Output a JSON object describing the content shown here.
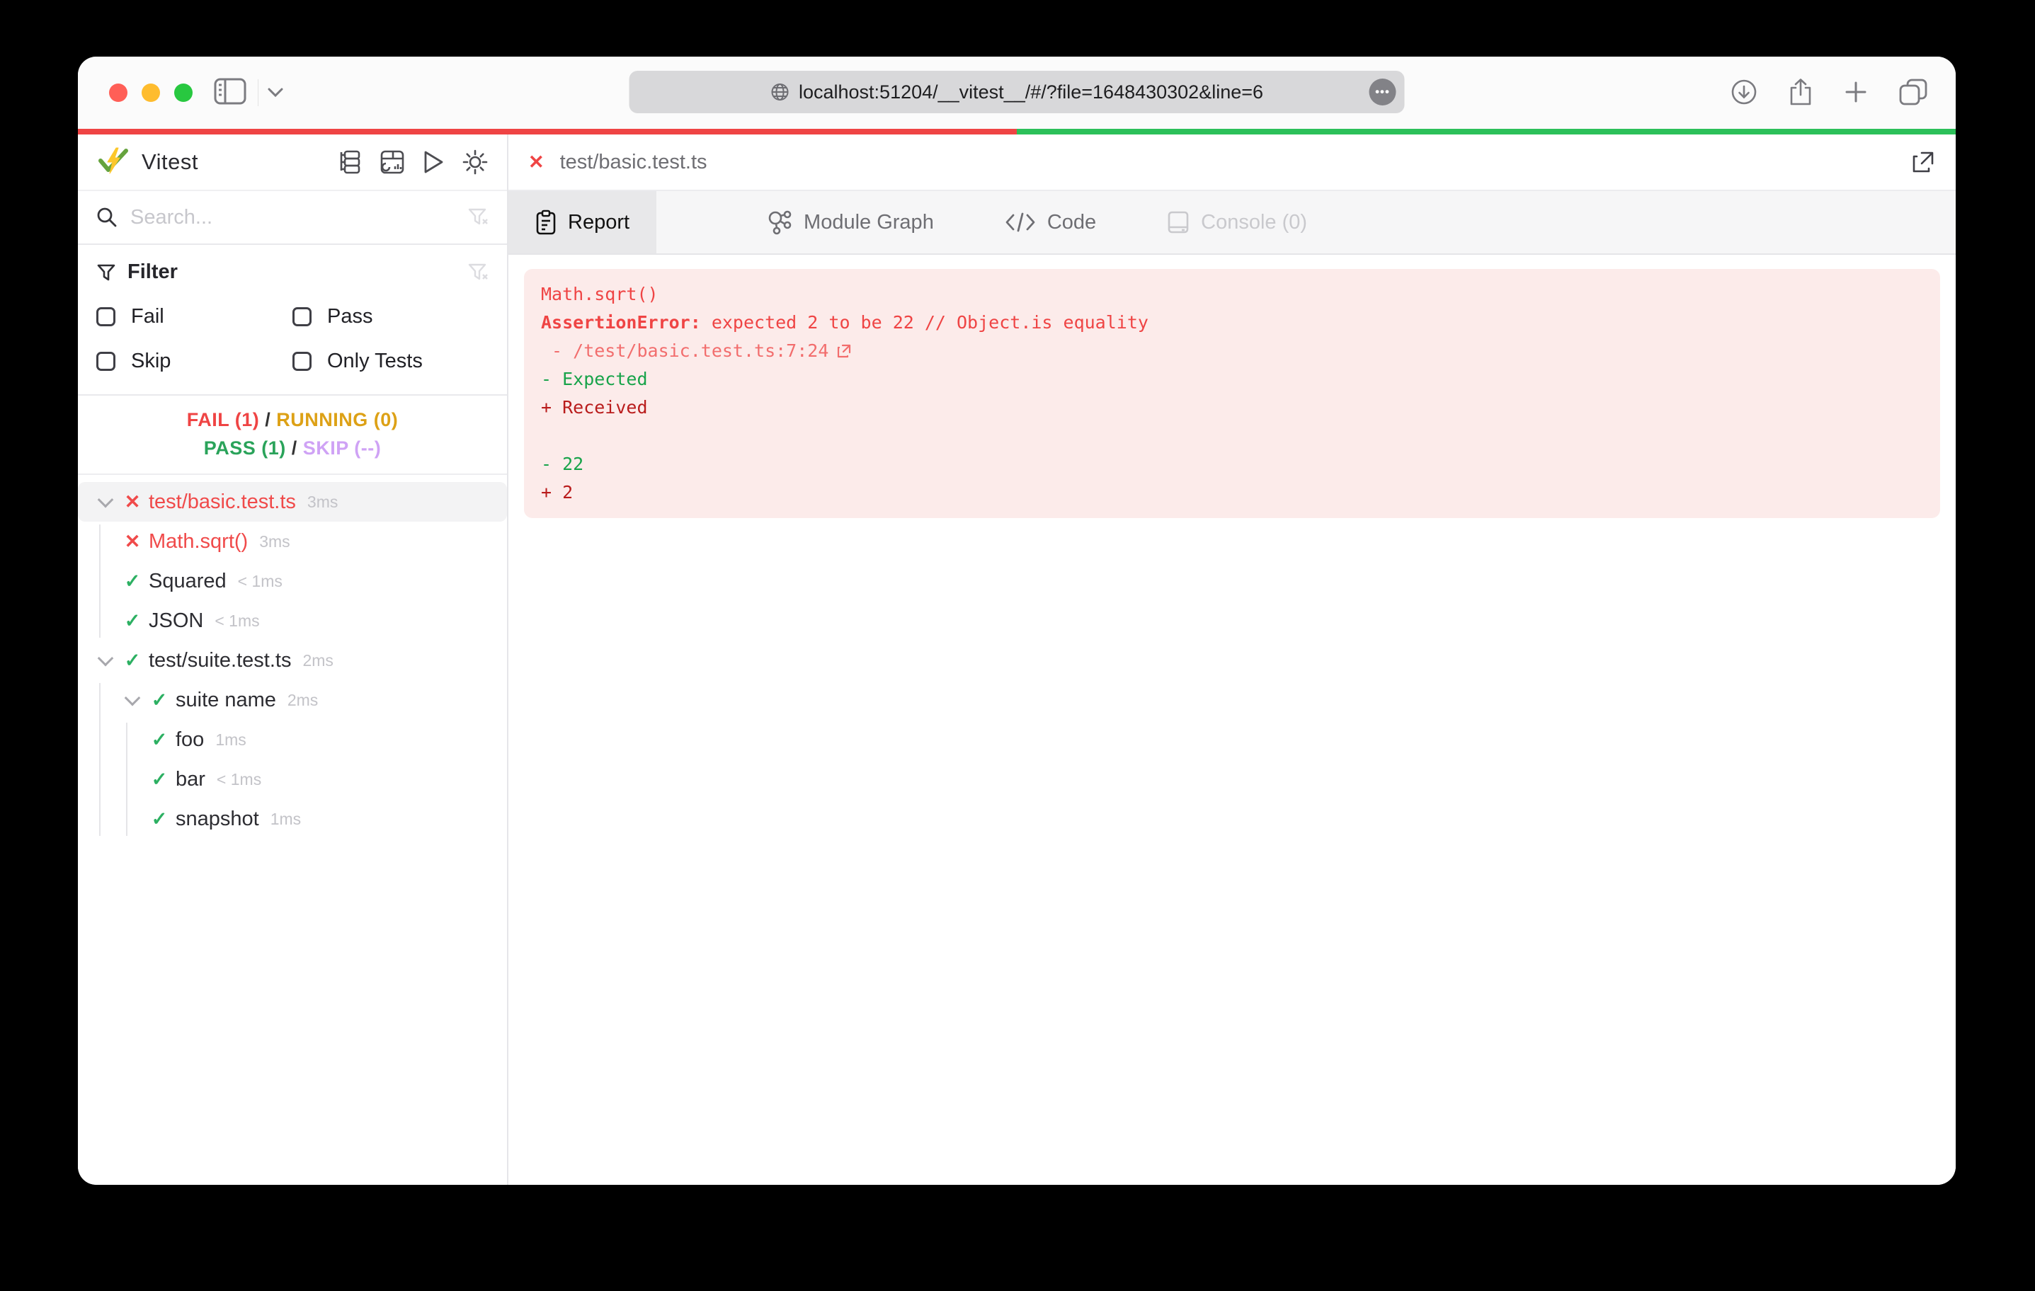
{
  "browser": {
    "url": "localhost:51204/__vitest__/#/?file=1648430302&line=6"
  },
  "colors": {
    "fail_red": "#ef4444",
    "pass_green": "#2cc05a",
    "running_amber": "#dda116",
    "skip_purple": "#cfa2f5",
    "error_panel_bg": "#fcebea",
    "diff_expected_green": "#18a34a",
    "diff_received_darkred": "#b91c1c"
  },
  "icons": {
    "fail_glyph": "✕",
    "pass_glyph": "✓"
  },
  "sidebar": {
    "title": "Vitest",
    "search_placeholder": "Search...",
    "filter": {
      "label": "Filter",
      "options": [
        "Fail",
        "Pass",
        "Skip",
        "Only Tests"
      ]
    },
    "summary": {
      "fail": "FAIL (1)",
      "running": "RUNNING (0)",
      "pass": "PASS (1)",
      "skip": "SKIP (--)",
      "sep": " / "
    },
    "tree": [
      {
        "label": "test/basic.test.ts",
        "duration": "3ms",
        "status": "fail",
        "level": 0,
        "expandable": true,
        "selected": true
      },
      {
        "label": "Math.sqrt()",
        "duration": "3ms",
        "status": "fail",
        "level": 1,
        "expandable": false,
        "selected": false
      },
      {
        "label": "Squared",
        "duration": "< 1ms",
        "status": "pass",
        "level": 1,
        "expandable": false,
        "selected": false
      },
      {
        "label": "JSON",
        "duration": "< 1ms",
        "status": "pass",
        "level": 1,
        "expandable": false,
        "selected": false
      },
      {
        "label": "test/suite.test.ts",
        "duration": "2ms",
        "status": "pass",
        "level": 0,
        "expandable": true,
        "selected": false
      },
      {
        "label": "suite name",
        "duration": "2ms",
        "status": "pass",
        "level": 1,
        "expandable": true,
        "selected": false
      },
      {
        "label": "foo",
        "duration": "1ms",
        "status": "pass",
        "level": 2,
        "expandable": false,
        "selected": false
      },
      {
        "label": "bar",
        "duration": "< 1ms",
        "status": "pass",
        "level": 2,
        "expandable": false,
        "selected": false
      },
      {
        "label": "snapshot",
        "duration": "1ms",
        "status": "pass",
        "level": 2,
        "expandable": false,
        "selected": false
      }
    ]
  },
  "main": {
    "file_tab": "test/basic.test.ts",
    "fail_mark": "✕",
    "tabs": [
      {
        "label": "Report"
      },
      {
        "label": "Module Graph"
      },
      {
        "label": "Code"
      },
      {
        "label": "Console (0)"
      }
    ],
    "report": {
      "lines": [
        {
          "name": "error-test-name",
          "color": "red",
          "parts": [
            {
              "text": "Math.sqrt()"
            }
          ]
        },
        {
          "name": "error-message",
          "color": "red",
          "parts": [
            {
              "text": "AssertionError: ",
              "bold": true
            },
            {
              "text": "expected 2 to be 22 // Object.is equality"
            }
          ]
        },
        {
          "name": "error-file-link",
          "color": "file",
          "link": true,
          "ext": true,
          "parts": [
            {
              "text": " - /test/basic.test.ts:7:24"
            }
          ]
        },
        {
          "name": "diff-expected-label",
          "color": "green",
          "parts": [
            {
              "text": "- Expected"
            }
          ]
        },
        {
          "name": "diff-received-label",
          "color": "darkred",
          "parts": [
            {
              "text": "+ Received"
            }
          ]
        },
        {
          "name": "blank-line",
          "color": "",
          "parts": [
            {
              "text": " "
            }
          ]
        },
        {
          "name": "diff-expected-value",
          "color": "green",
          "parts": [
            {
              "text": "- 22"
            }
          ]
        },
        {
          "name": "diff-received-value",
          "color": "darkred",
          "parts": [
            {
              "text": "+ 2"
            }
          ]
        }
      ]
    }
  }
}
